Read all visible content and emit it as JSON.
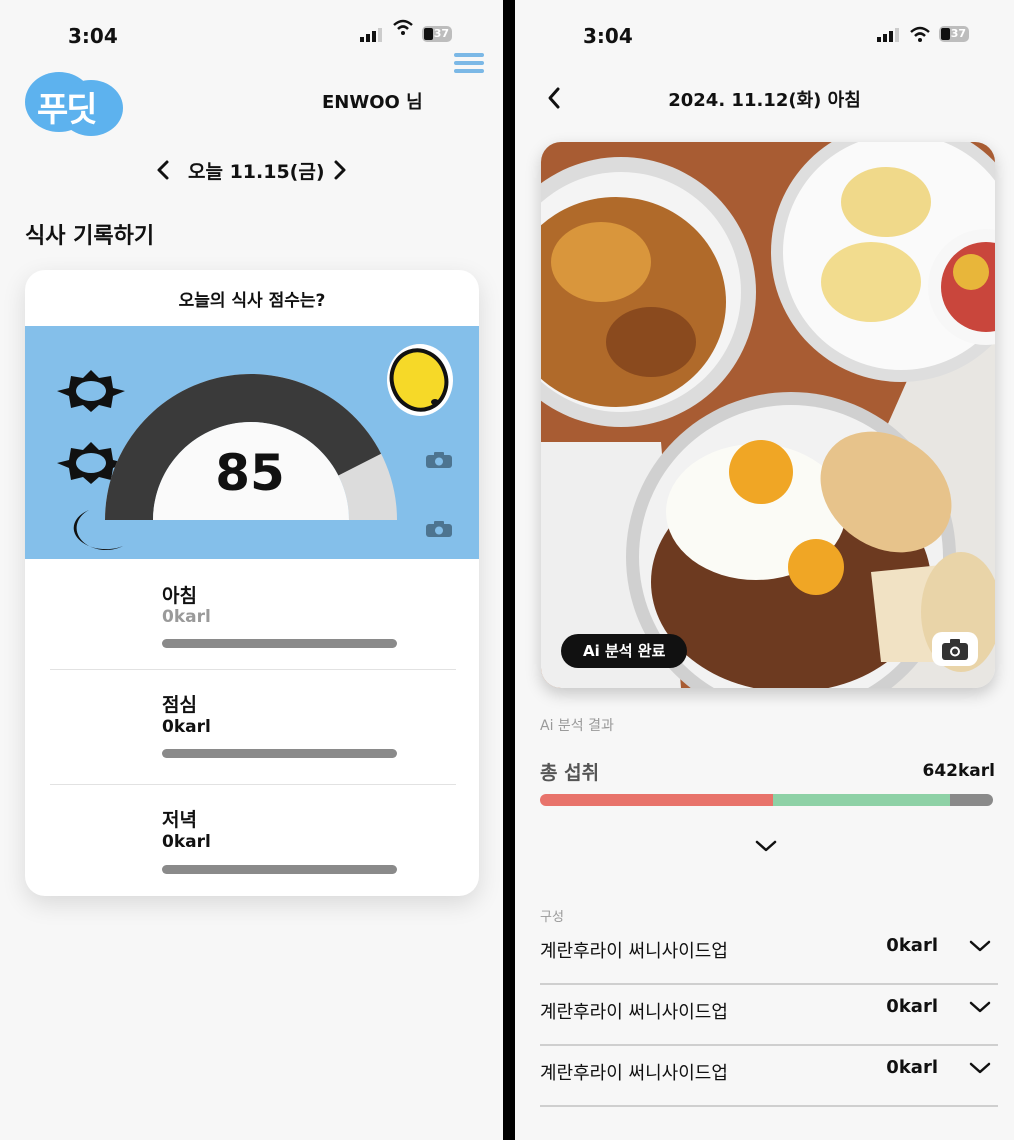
{
  "left": {
    "status_time": "3:04",
    "battery": "37",
    "logo_text": "푸딧",
    "user_name": "ENWOO 님",
    "date_label": "오늘 11.15(금)",
    "section_title": "식사 기록하기",
    "card": {
      "title": "오늘의 식사 점수는?",
      "score": "85",
      "score_fraction": 0.85,
      "meals": [
        {
          "name": "아침",
          "calories": "0karl",
          "muted": true
        },
        {
          "name": "점심",
          "calories": "0karl",
          "muted": false
        },
        {
          "name": "저녁",
          "calories": "0karl",
          "muted": false
        }
      ]
    }
  },
  "right": {
    "status_time": "3:04",
    "battery": "37",
    "header_title": "2024. 11.12(화) 아침",
    "photo_badge": "Ai 분석 완료",
    "analysis_label": "Ai 분석 결과",
    "total_label": "총 섭취",
    "total_value": "642karl",
    "intake_segments": [
      {
        "fraction": 0.515,
        "color": "#e8736b"
      },
      {
        "fraction": 0.39,
        "color": "#8ed1a6"
      },
      {
        "fraction": 0.095,
        "color": "#8a8a8a"
      }
    ],
    "composition_label": "구성",
    "components": [
      {
        "name": "계란후라이 써니사이드업",
        "calories": "0karl"
      },
      {
        "name": "계란후라이 써니사이드업",
        "calories": "0karl"
      },
      {
        "name": "계란후라이 써니사이드업",
        "calories": "0karl"
      }
    ]
  }
}
